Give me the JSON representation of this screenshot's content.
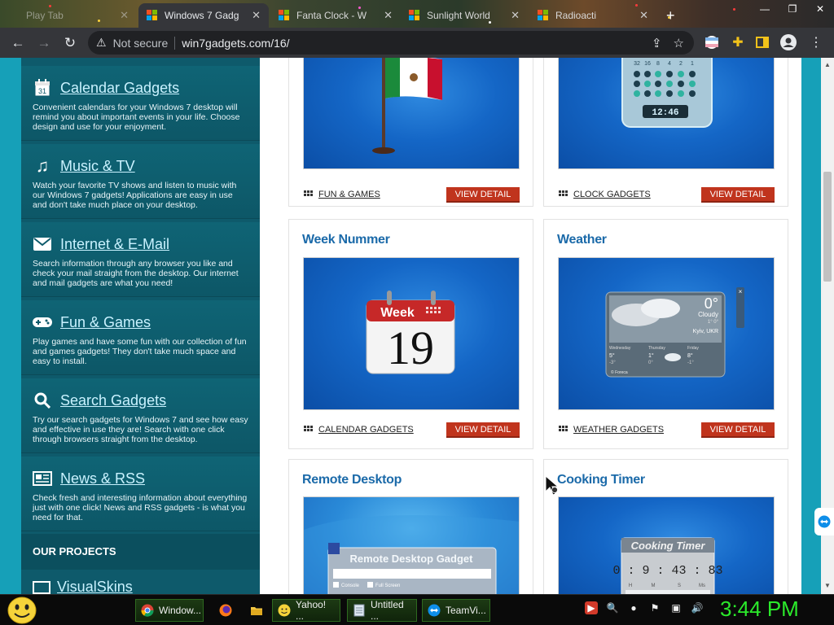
{
  "browser": {
    "tabs": [
      {
        "label": "Play Tab"
      },
      {
        "label": "Windows 7 Gadg"
      },
      {
        "label": "Fanta Clock - W"
      },
      {
        "label": "Sunlight World"
      },
      {
        "label": "Radioacti"
      }
    ],
    "address": {
      "security": "Not secure",
      "url": "win7gadgets.com/16/"
    }
  },
  "sidebar": {
    "items": [
      {
        "title": "Calendar Gadgets",
        "icon": "calendar-icon",
        "icon_text": "31",
        "desc": "Convenient calendars for your Windows 7 desktop will remind you about important events in your life. Choose design and use for your enjoyment."
      },
      {
        "title": "Music & TV",
        "icon": "music-note-icon",
        "desc": "Watch your favorite TV shows and listen to music with our Windows 7 gadgets! Applications are easy in use and don't take much place on your desktop."
      },
      {
        "title": "Internet & E-Mail",
        "icon": "envelope-icon",
        "desc": "Search information through any browser you like and check your mail straight from the desktop. Our internet and mail gadgets are what you need!"
      },
      {
        "title": "Fun & Games",
        "icon": "gamepad-icon",
        "desc": "Play games and have some fun with our collection of fun and games gadgets! They don't take much space and easy to install."
      },
      {
        "title": "Search Gadgets",
        "icon": "magnifier-icon",
        "desc": "Try our search gadgets for Windows 7 and see how easy and effective in use they are! Search with one click through browsers straight from the desktop."
      },
      {
        "title": "News & RSS",
        "icon": "newspaper-icon",
        "desc": "Check fresh and interesting information about everything just with one click! News and RSS gadgets - is what you need for that."
      }
    ],
    "projects_heading": "OUR PROJECTS",
    "projects": [
      {
        "title": "VisualSkins"
      }
    ]
  },
  "cards": [
    {
      "title": "",
      "category": "FUN & GAMES",
      "button": "VIEW DETAIL"
    },
    {
      "title": "",
      "category": "CLOCK GADGETS",
      "button": "VIEW DETAIL",
      "clock_time": "12:46",
      "clock_digits": [
        "32",
        "16",
        "8",
        "4",
        "2",
        "1"
      ]
    },
    {
      "title": "Week Nummer",
      "category": "CALENDAR GADGETS",
      "button": "VIEW DETAIL",
      "week_label": "Week",
      "week_number": "19"
    },
    {
      "title": "Weather",
      "category": "WEATHER GADGETS",
      "button": "VIEW DETAIL",
      "weather": {
        "temp": "0°",
        "condition": "Cloudy",
        "range": "1° 0°",
        "location": "Kyiv, UKR",
        "source": "© Foreca",
        "days": [
          {
            "name": "Wednesday",
            "hi": "5°",
            "lo": "-3°"
          },
          {
            "name": "Thursday",
            "hi": "1°",
            "lo": "0°"
          },
          {
            "name": "Friday",
            "hi": "8°",
            "lo": "-1°"
          }
        ]
      }
    },
    {
      "title": "Remote Desktop",
      "category": "",
      "button": "",
      "gadget_title": "Remote Desktop Gadget",
      "opt1": "Console",
      "opt2": "Full Screen"
    },
    {
      "title": "Cooking Timer",
      "category": "",
      "button": "",
      "timer_title": "Cooking Timer",
      "timer_value": "0 : 9 : 43 : 83",
      "timer_units": [
        "H",
        "M",
        "S",
        "Ms"
      ]
    }
  ],
  "taskbar": {
    "buttons": [
      {
        "label": "Window...",
        "icon": "chrome-icon"
      },
      {
        "label": "",
        "icon": "firefox-icon"
      },
      {
        "label": "",
        "icon": "folder-icon"
      },
      {
        "label": "Yahoo! ...",
        "icon": "yahoo-smiley-icon"
      },
      {
        "label": "Untitled ...",
        "icon": "notepad-icon"
      },
      {
        "label": "TeamVi...",
        "icon": "teamviewer-icon"
      }
    ],
    "clock": "3:44 PM"
  }
}
